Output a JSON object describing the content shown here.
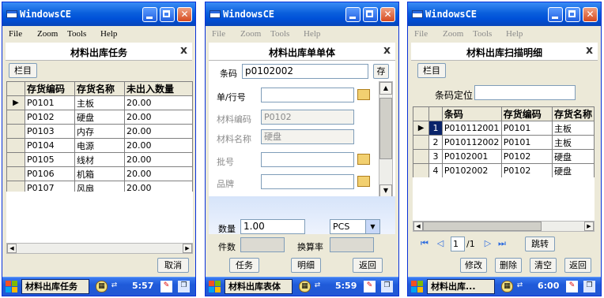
{
  "colors": {
    "titlebar": "#0a5fdc",
    "window_bg": "#ece9d8",
    "taskbar": "#1f5ad9"
  },
  "windows": [
    {
      "title": "WindowsCE",
      "menu": [
        "File",
        "Zoom",
        "Tools",
        "Help"
      ],
      "form_title": "材料出库任务",
      "form_close": "x",
      "columns_button": "栏目",
      "table": {
        "headers": [
          "存货编码",
          "存货名称",
          "未出入数量"
        ],
        "rows": [
          [
            "P0101",
            "主板",
            "20.00"
          ],
          [
            "P0102",
            "硬盘",
            "20.00"
          ],
          [
            "P0103",
            "内存",
            "20.00"
          ],
          [
            "P0104",
            "电源",
            "20.00"
          ],
          [
            "P0105",
            "线材",
            "20.00"
          ],
          [
            "P0106",
            "机箱",
            "20.00"
          ],
          [
            "P0107",
            "风扇",
            "20.00"
          ]
        ]
      },
      "cancel_button": "取消",
      "taskbar": {
        "task": "材料出库任务",
        "time": "5:57"
      }
    },
    {
      "title": "WindowsCE",
      "menu": [
        "File",
        "Zoom",
        "Tools",
        "Help"
      ],
      "form_title": "材料出库单单体",
      "form_close": "x",
      "barcode_label": "条码",
      "barcode_value": "p0102002",
      "save_button": "存",
      "order_label": "单/行号",
      "material_code_label": "材料编码",
      "material_code_value": "P0102",
      "material_name_label": "材料名称",
      "material_name_value": "硬盘",
      "batch_label": "批号",
      "brand_label": "品牌",
      "quantity_label": "数量",
      "quantity_value": "1.00",
      "unit_value": "PCS",
      "pieces_label": "件数",
      "rate_label": "换算率",
      "task_button": "任务",
      "detail_button": "明细",
      "back_button": "返回",
      "taskbar": {
        "task": "材料出库表体",
        "time": "5:59"
      }
    },
    {
      "title": "WindowsCE",
      "menu": [
        "File",
        "Zoom",
        "Tools",
        "Help"
      ],
      "form_title": "材料出库扫描明细",
      "form_close": "x",
      "columns_button": "栏目",
      "locate_label": "条码定位",
      "table": {
        "headers": [
          "条码",
          "存货编码",
          "存货名称"
        ],
        "rows": [
          [
            "1",
            "P010112001",
            "P0101",
            "主板"
          ],
          [
            "2",
            "P010112002",
            "P0101",
            "主板"
          ],
          [
            "3",
            "P0102001",
            "P0102",
            "硬盘"
          ],
          [
            "4",
            "P0102002",
            "P0102",
            "硬盘"
          ]
        ]
      },
      "pager": {
        "page": "1",
        "total": "/1",
        "jump_button": "跳转"
      },
      "modify_button": "修改",
      "delete_button": "删除",
      "clear_button": "清空",
      "back_button": "返回",
      "taskbar": {
        "task": "材料出库...",
        "time": "6:00"
      }
    }
  ]
}
